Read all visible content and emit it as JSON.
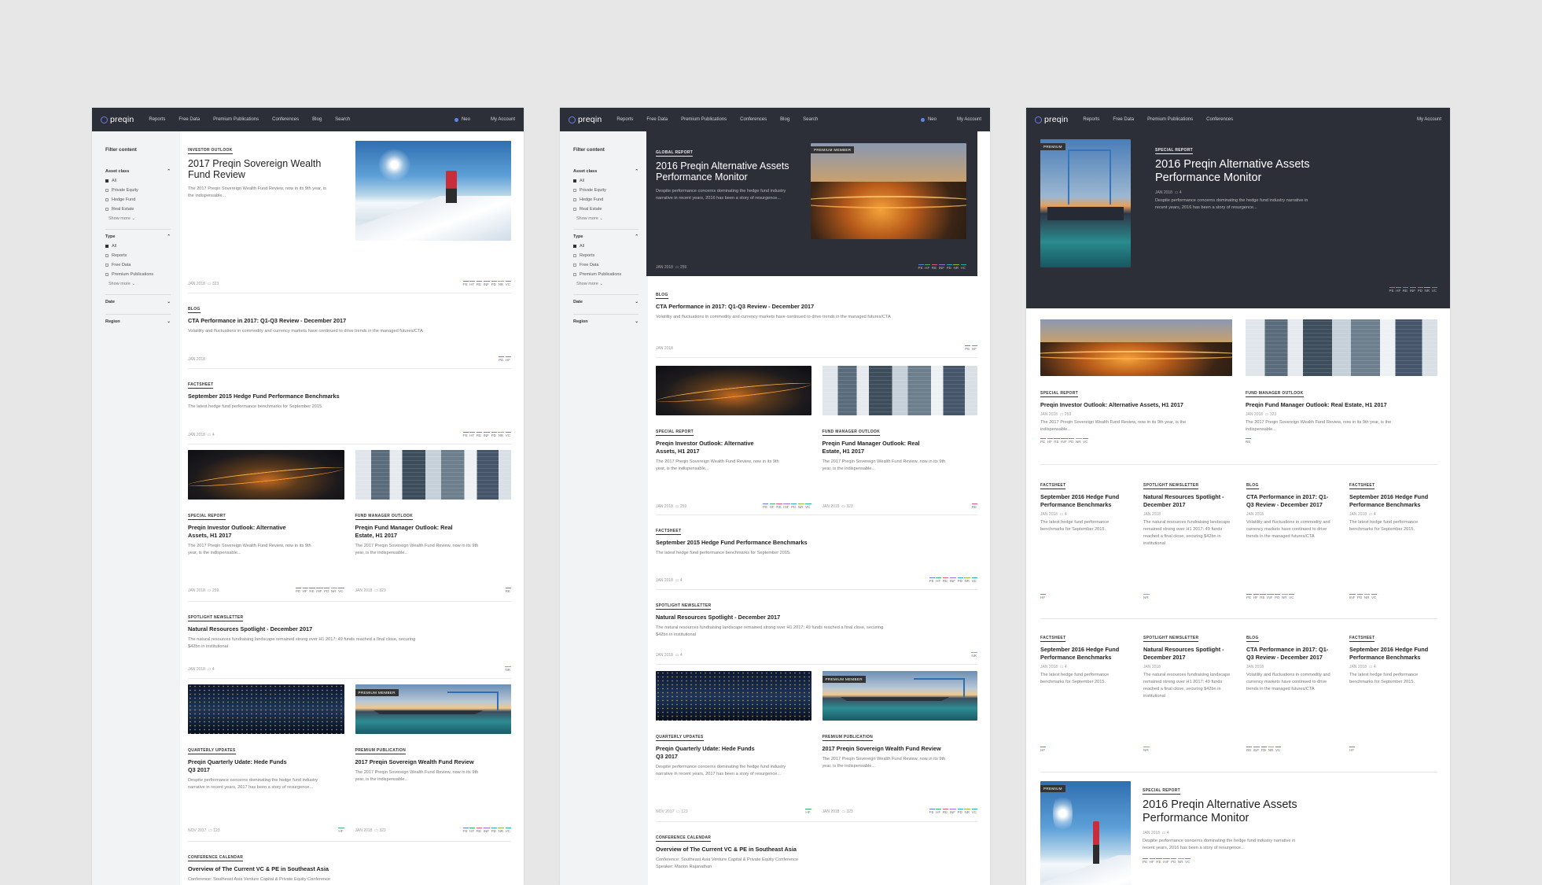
{
  "nav": {
    "logo": "preqin",
    "items": [
      "Reports",
      "Free Data",
      "Premium Publications",
      "Conferences",
      "Blog",
      "Search"
    ],
    "items_short": [
      "Reports",
      "Free Data",
      "Premium Publications",
      "Conferences"
    ],
    "user": "Neo",
    "account": "My Account"
  },
  "sidebar": {
    "title": "Filter content",
    "asset_class": {
      "label": "Asset class",
      "options": [
        "All",
        "Private Equity",
        "Hedge Fund",
        "Real Estate"
      ],
      "more": "Show more"
    },
    "type": {
      "label": "Type",
      "options": [
        "All",
        "Reports",
        "Free Data",
        "Premium Publications"
      ],
      "more": "Show more"
    },
    "date": "Date",
    "region": "Region"
  },
  "colors": {
    "nav_bg": "#2c2f38",
    "accent": "#6d7ee8"
  },
  "chips_all": [
    "PE",
    "HF",
    "RE",
    "INF",
    "PD",
    "NR",
    "VC"
  ],
  "chips_hf": [
    "HF"
  ],
  "chips_pe_hf": [
    "PE",
    "HF"
  ],
  "chips_nr": [
    "NR"
  ],
  "chips_re": [
    "RE"
  ],
  "chips_mix": [
    "INF",
    "PD",
    "NR",
    "VC"
  ],
  "chips_mix2": [
    "RE",
    "INF",
    "PD",
    "NR",
    "VC"
  ],
  "frame1": {
    "hero": {
      "tag": "Investor outlook",
      "title": "2017 Preqin Sovereign Wealth Fund Review",
      "desc": "The 2017 Preqin Sovereign Wealth Fund Review, now in its 9th year, is the indispensable...",
      "date": "JAN 2018",
      "count": "323"
    },
    "blog": {
      "tag": "Blog",
      "title": "CTA Performance in 2017: Q1-Q3 Review - December 2017",
      "desc": "Volatility and fluctuations in commodity and currency markets have continued to drive trends in the managed futures/CTA",
      "date": "JAN 2018"
    },
    "factsheet": {
      "tag": "Factsheet",
      "title": "September 2015 Hedge Fund Performance Benchmarks",
      "desc": "The latest hedge fund performance benchmarks for September 2015.",
      "date": "JAN 2018",
      "count": "4"
    },
    "card_a": {
      "tag": "Special report",
      "title": "Preqin Investor Outlook: Alternative Assets, H1 2017",
      "desc": "The 2017 Preqin Sovereign Wealth Fund Review, now in its 9th year, is the indispensable...",
      "date": "JAN 2018",
      "count": "259"
    },
    "card_b": {
      "tag": "Fund manager outlook",
      "title": "Preqin Fund Manager Outlook: Real Estate, H1 2017",
      "desc": "The 2017 Preqin Sovereign Wealth Fund Review, now in its 9th year, is the indispensable...",
      "date": "JAN 2018",
      "count": "323"
    },
    "spot": {
      "tag": "Spotlight newsletter",
      "title": "Natural Resources Spotlight - December 2017",
      "desc": "The natural resources fundraising landscape remained strong over H1 2017: 49 funds reached a final close, securing $42bn in institutional",
      "date": "JAN 2018",
      "count": "4"
    },
    "card_c": {
      "tag": "Quarterly updates",
      "title": "Preqin Quarterly Udate: Hede Funds Q3 2017",
      "desc": "Despite performance concerns dominating the hedge fund industry narrative in recent years, 2017 has been a story of resurgence...",
      "date": "NOV 2017",
      "count": "123"
    },
    "card_d": {
      "badge": "Premium member",
      "tag": "Premium publication",
      "title": "2017 Preqin Sovereign Wealth Fund Review",
      "desc": "The 2017 Preqin Sovereign Wealth Fund Review, now in its 9th year, is the indispensable...",
      "date": "JAN 2018",
      "count": "323"
    },
    "conf": {
      "tag": "Conference calendar",
      "title": "Overview of The Current VC & PE in Southeast Asia",
      "desc": "Conference: Southeast Asia Venture Capital & Private Equity Conference"
    }
  },
  "frame2": {
    "hero": {
      "tag": "Global report",
      "badge": "Premium member",
      "title": "2016 Preqin Alternative Assets Performance Monitor",
      "desc": "Despite performance concerns dominating the hedge fund industry narrative in recent years, 2016 has been a story of resurgence...",
      "date": "JAN 2018",
      "count": "259"
    },
    "speaker": "Speaker: Marion Rajanathan"
  },
  "frame3": {
    "hero": {
      "badge": "Premium",
      "tag": "Special report",
      "title": "2016 Preqin Alternative Assets Performance Monitor",
      "desc": "Despite performance concerns dominating the hedge fund industry narrative in recent years, 2016 has been a story of resurgence...",
      "date": "JAN 2018",
      "count": "4"
    },
    "small": [
      {
        "tag": "Factsheet",
        "title": "September 2016 Hedge Fund Performance Benchmarks",
        "date": "JAN 2018",
        "count": "4",
        "desc": "The latest hedge fund performance benchmarks for September 2015."
      },
      {
        "tag": "Spotlight newsletter",
        "title": "Natural Resources Spotlight - December 2017",
        "date": "JAN 2018",
        "count": "",
        "desc": "The natural resources fundraising landscape remained strong over H1 2017: 49 funds reached a final close, securing $42bn in institutional"
      },
      {
        "tag": "Blog",
        "title": "CTA Performance in 2017: Q1-Q3 Review - December 2017",
        "date": "JAN 2018",
        "count": "",
        "desc": "Volatility and fluctuations in commodity and currency markets have continued to drive trends in the managed futures/CTA"
      },
      {
        "tag": "Factsheet",
        "title": "September 2016 Hedge Fund Performance Benchmarks",
        "date": "JAN 2018",
        "count": "4",
        "desc": "The latest hedge fund performance benchmarks for September 2015."
      }
    ]
  }
}
